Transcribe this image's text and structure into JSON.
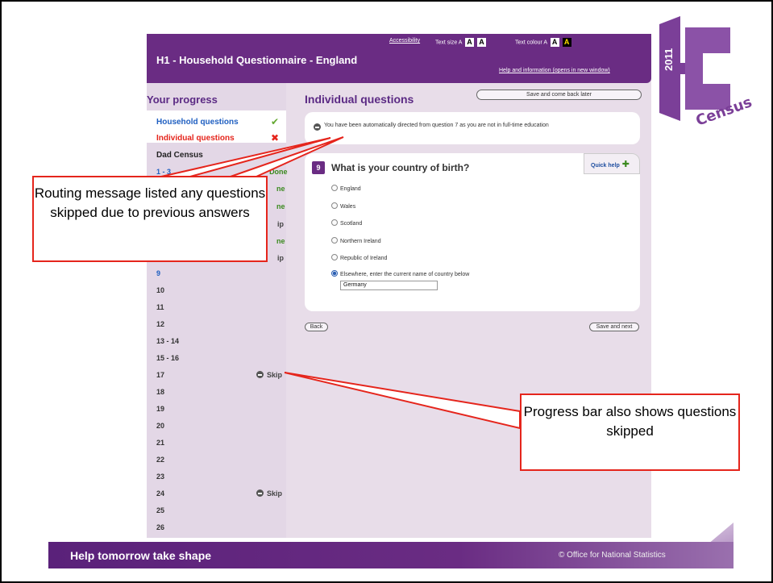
{
  "banner": {
    "title": "H1 - Household Questionnaire - England",
    "accessibility": "Accessibility",
    "text_size_label": "Text size",
    "text_colour_label": "Text colour",
    "size_letter": "A",
    "help_link": "Help and information (opens in new window)"
  },
  "progress": {
    "heading": "Your progress",
    "household": "Household questions",
    "individual": "Individual questions",
    "person": "Dad Census",
    "rows": [
      {
        "label": "1 - 3",
        "status": "Done"
      },
      {
        "label": "9",
        "status": ""
      },
      {
        "label": "10",
        "status": ""
      },
      {
        "label": "11",
        "status": ""
      },
      {
        "label": "12",
        "status": ""
      },
      {
        "label": "13 - 14",
        "status": ""
      },
      {
        "label": "15 - 16",
        "status": ""
      },
      {
        "label": "17",
        "status": "Skip"
      },
      {
        "label": "18",
        "status": ""
      },
      {
        "label": "19",
        "status": ""
      },
      {
        "label": "20",
        "status": ""
      },
      {
        "label": "21",
        "status": ""
      },
      {
        "label": "22",
        "status": ""
      },
      {
        "label": "23",
        "status": ""
      },
      {
        "label": "24",
        "status": "Skip"
      },
      {
        "label": "25",
        "status": ""
      },
      {
        "label": "26",
        "status": ""
      }
    ],
    "partial_status": [
      "ne",
      "ne",
      "ip",
      "ne",
      "ip"
    ]
  },
  "main": {
    "heading": "Individual questions",
    "save_later": "Save and come back later",
    "routing_message": "You have been automatically directed from question 7 as you are not in full-time education",
    "question_number": "9",
    "question_text": "What is your country of birth?",
    "quick_help": "Quick help",
    "options": [
      "England",
      "Wales",
      "Scotland",
      "Northern Ireland",
      "Republic of Ireland",
      "Elsewhere, enter the current name of country below"
    ],
    "country_value": "Germany",
    "back": "Back",
    "save_next": "Save and next"
  },
  "logo": {
    "year": "2011",
    "word": "Census"
  },
  "callouts": {
    "routing": "Routing message listed any questions skipped due to previous answers",
    "progress": "Progress bar also shows questions skipped"
  },
  "footer": {
    "tagline": "Help tomorrow take shape",
    "copyright": "© Office for National Statistics"
  },
  "colors": {
    "brand_purple": "#6a2c83",
    "callout_red": "#e5251c",
    "done_green": "#3b8a1f",
    "link_blue": "#1f5fc1"
  }
}
